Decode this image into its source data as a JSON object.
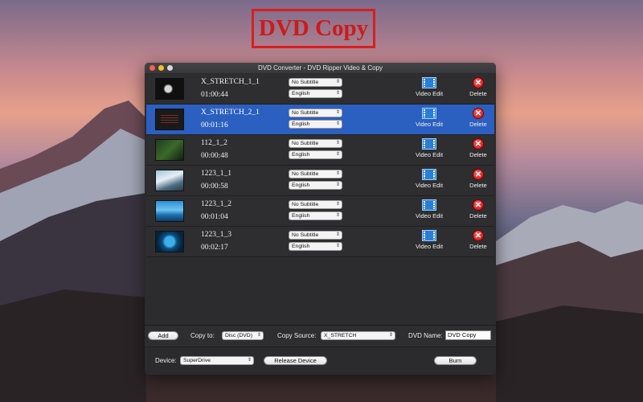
{
  "promo_title": "DVD Copy",
  "window": {
    "title": "DVD Converter - DVD Ripper Video & Copy"
  },
  "items": [
    {
      "name": "X_STRETCH_1_1",
      "duration": "01:00:44",
      "subtitle": "No Subtitle",
      "audio": "English",
      "edit_label": "Video Edit",
      "delete_label": "Delete",
      "selected": false
    },
    {
      "name": "X_STRETCH_2_1",
      "duration": "00:01:16",
      "subtitle": "No Subtitle",
      "audio": "English",
      "edit_label": "Video Edit",
      "delete_label": "Delete",
      "selected": true
    },
    {
      "name": "112_1_2",
      "duration": "00:00:48",
      "subtitle": "No Subtitle",
      "audio": "English",
      "edit_label": "Video Edit",
      "delete_label": "Delete",
      "selected": false
    },
    {
      "name": "1223_1_1",
      "duration": "00:00:58",
      "subtitle": "No Subtitle",
      "audio": "English",
      "edit_label": "Video Edit",
      "delete_label": "Delete",
      "selected": false
    },
    {
      "name": "1223_1_2",
      "duration": "00:01:04",
      "subtitle": "No Subtitle",
      "audio": "English",
      "edit_label": "Video Edit",
      "delete_label": "Delete",
      "selected": false
    },
    {
      "name": "1223_1_3",
      "duration": "00:02:17",
      "subtitle": "No Subtitle",
      "audio": "English",
      "edit_label": "Video Edit",
      "delete_label": "Delete",
      "selected": false
    }
  ],
  "controls": {
    "add_label": "Add",
    "copy_to_label": "Copy to:",
    "copy_to_value": "Disc (DVD)",
    "copy_source_label": "Copy Source:",
    "copy_source_value": "X_STRETCH",
    "dvd_name_label": "DVD Name:",
    "dvd_name_value": "DVD Copy",
    "device_label": "Device:",
    "device_value": "SuperDrive",
    "release_label": "Release Device",
    "burn_label": "Burn"
  },
  "colors": {
    "selection": "#2b5fc0",
    "promo_red": "#d62020"
  }
}
